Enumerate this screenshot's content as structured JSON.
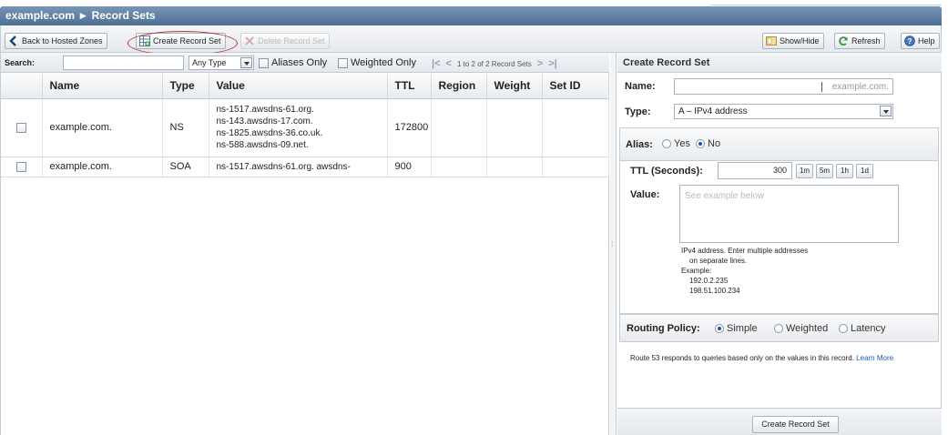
{
  "window": {
    "title": "example.com ► Record Sets"
  },
  "toolbar": {
    "back_label": "Back to Hosted Zones",
    "create_label": "Create Record Set",
    "delete_label": "Delete Record Set",
    "showhide_label": "Show/Hide",
    "refresh_label": "Refresh",
    "help_label": "Help"
  },
  "search": {
    "label": "Search:",
    "value": "",
    "type_selected": "Any Type",
    "aliases_only": "Aliases Only",
    "weighted_only": "Weighted Only",
    "pager_text": "1 to 2 of 2 Record Sets"
  },
  "table": {
    "columns": [
      "Name",
      "Type",
      "Value",
      "TTL",
      "Region",
      "Weight",
      "Set ID"
    ],
    "rows": [
      {
        "name": "example.com.",
        "type": "NS",
        "value_lines": [
          "ns-1517.awsdns-61.org.",
          "ns-143.awsdns-17.com.",
          "ns-1825.awsdns-36.co.uk.",
          "ns-588.awsdns-09.net."
        ],
        "ttl": "172800",
        "region": "",
        "weight": "",
        "set_id": ""
      },
      {
        "name": "example.com.",
        "type": "SOA",
        "value_lines": [
          "ns-1517.awsdns-61.org. awsdns-"
        ],
        "ttl": "900",
        "region": "",
        "weight": "",
        "set_id": ""
      }
    ]
  },
  "form": {
    "header": "Create Record Set",
    "name_label": "Name:",
    "name_value": "",
    "name_suffix": "example.com.",
    "type_label": "Type:",
    "type_selected": "A – IPv4 address",
    "alias_label": "Alias:",
    "alias_yes": "Yes",
    "alias_no": "No",
    "ttl_label": "TTL (Seconds):",
    "ttl_value": "300",
    "ttl_buttons": [
      "1m",
      "5m",
      "1h",
      "1d"
    ],
    "value_label": "Value:",
    "value_placeholder": "See example below",
    "help_line1": "IPv4 address. Enter multiple addresses",
    "help_line2": "on separate lines.",
    "help_example": "Example:",
    "help_ip1": "192.0.2.235",
    "help_ip2": "198.51.100.234",
    "routing_label": "Routing Policy:",
    "routing_simple": "Simple",
    "routing_weighted": "Weighted",
    "routing_latency": "Latency",
    "routing_desc": "Route 53 responds to queries based only on the values in this record.",
    "routing_link": "Learn More",
    "submit_label": "Create Record Set"
  },
  "colors": {
    "titlebar": "#5a7aa0",
    "accent_link": "#1a5fb4",
    "highlight_oval": "#c0322f"
  }
}
